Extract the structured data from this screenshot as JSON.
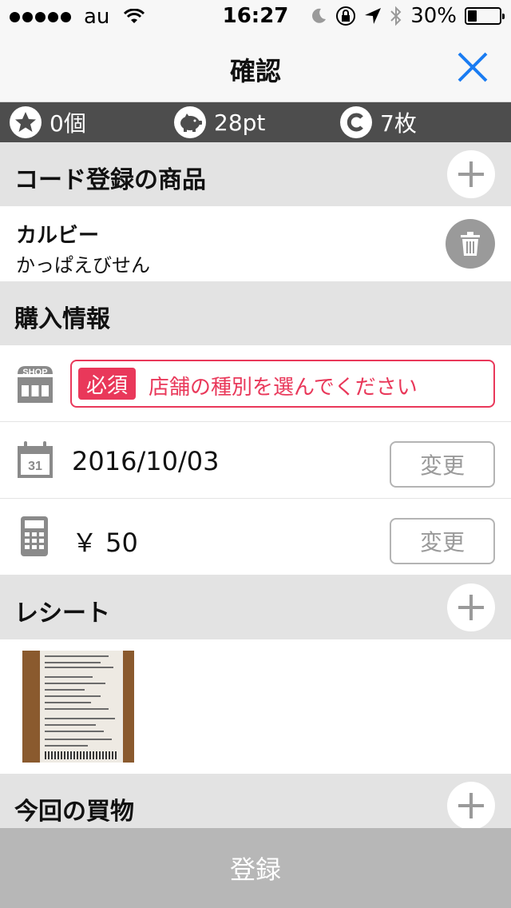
{
  "status_bar": {
    "carrier": "au",
    "time": "16:27",
    "battery": "30%"
  },
  "nav": {
    "title": "確認"
  },
  "points": [
    {
      "icon": "star-icon",
      "value": "0個"
    },
    {
      "icon": "piggy-bank-icon",
      "value": "28pt"
    },
    {
      "icon": "coupon-c-icon",
      "value": "7枚"
    }
  ],
  "code_products": {
    "title": "コード登録の商品",
    "item": {
      "brand": "カルビー",
      "name": "かっぱえびせん"
    }
  },
  "purchase_info": {
    "title": "購入情報",
    "shop": {
      "icon_label": "SHOP",
      "required_label": "必須",
      "placeholder": "店舗の種別を選んでください"
    },
    "date": {
      "icon_label": "31",
      "value": "2016/10/03",
      "change_label": "変更"
    },
    "price": {
      "value": "￥ 50",
      "change_label": "変更"
    }
  },
  "receipt": {
    "title": "レシート"
  },
  "current_shopping": {
    "title": "今回の買物"
  },
  "register_label": "登録",
  "colors": {
    "accent": "#1a7cf2",
    "required": "#e9385a",
    "section_bg": "#e3e3e3",
    "points_bar": "#4d4d4d"
  }
}
